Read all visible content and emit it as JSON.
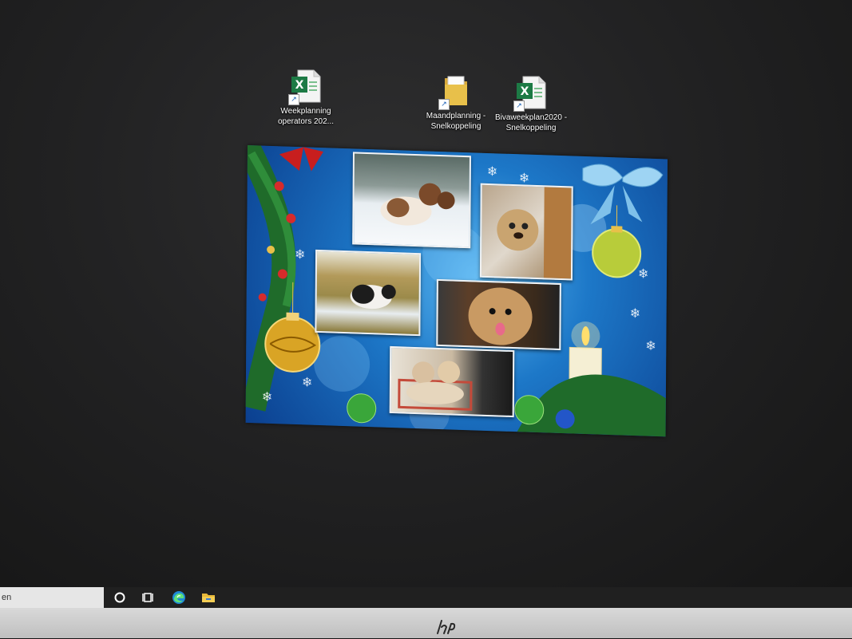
{
  "desktop": {
    "icons": [
      {
        "label_line1": "Weekplanning",
        "label_line2": "operators 202...",
        "icon": "excel-file-icon"
      },
      {
        "label_line1": "Maandplanning -",
        "label_line2": "Snelkoppeling",
        "icon": "folder-icon"
      },
      {
        "label_line1": "Bivaweekplan2020 -",
        "label_line2": "Snelkoppeling",
        "icon": "excel-file-icon"
      }
    ],
    "wallpaper_theme": "christmas-dog-collage"
  },
  "taskbar": {
    "search_placeholder": "en",
    "icons": [
      "cortana-icon",
      "task-view-icon",
      "edge-icon",
      "file-explorer-icon"
    ]
  },
  "monitor": {
    "brand_logo": "hp"
  },
  "colors": {
    "excel_green": "#1d7a45",
    "folder_yellow": "#e8c04a",
    "wallpaper_blue": "#1d78c8",
    "taskbar": "#202020"
  }
}
